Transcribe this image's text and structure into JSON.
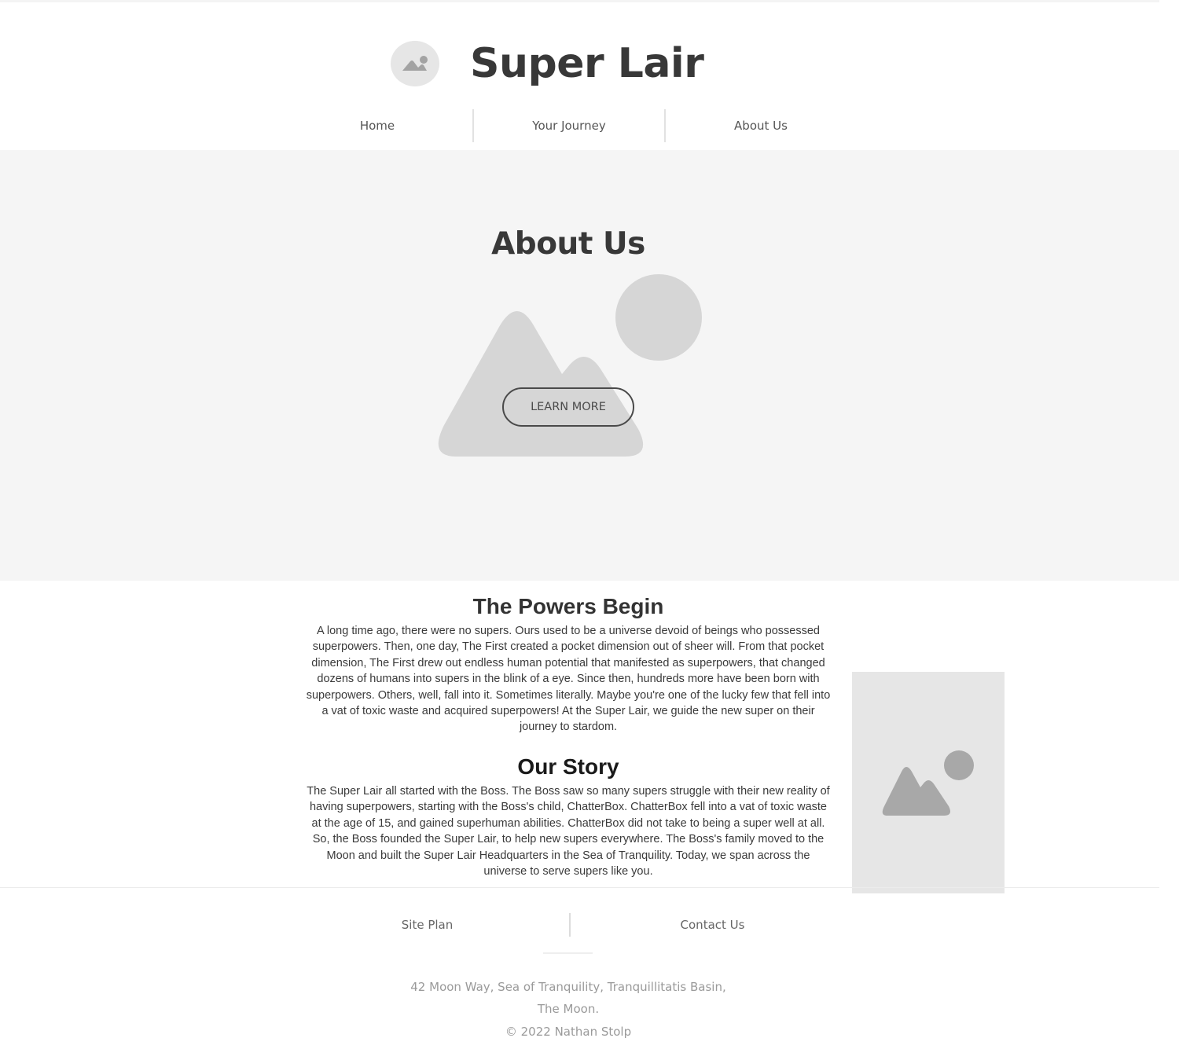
{
  "header": {
    "site_title": "Super Lair",
    "logo_icon": "image-placeholder-icon",
    "nav": [
      {
        "label": "Home"
      },
      {
        "label": "Your Journey"
      },
      {
        "label": "About Us"
      }
    ]
  },
  "hero": {
    "title": "About Us",
    "background_icon": "image-placeholder-icon",
    "cta_label": "LEARN MORE"
  },
  "sections": [
    {
      "title": "The Powers Begin",
      "body": "A long time ago, there were no supers. Ours used to be a universe devoid of beings who possessed superpowers. Then, one day, The First created a pocket dimension out of sheer will. From that pocket dimension, The First drew out endless human potential that manifested as superpowers, that changed dozens of humans into supers in the blink of a eye. Since then, hundreds more have been born with superpowers. Others, well, fall into it. Sometimes literally. Maybe you're one of the lucky few that fell into a vat of toxic waste and acquired superpowers! At the Super Lair, we guide the new super on their journey to stardom."
    },
    {
      "title": "Our Story",
      "body": "The Super Lair all started with the Boss. The Boss saw so many supers struggle with their new reality of having superpowers, starting with the Boss's child, ChatterBox. ChatterBox fell into a vat of toxic waste at the age of 15, and gained superhuman abilities. ChatterBox did not take to being a super well at all. So, the Boss founded the Super Lair, to help new supers everywhere. The Boss's family moved to the Moon and built the Super Lair Headquarters in the Sea of Tranquility. Today, we span across the universe to serve supers like you."
    }
  ],
  "side_image_icon": "image-placeholder-icon",
  "footer": {
    "links": [
      {
        "label": "Site Plan"
      },
      {
        "label": "Contact Us"
      }
    ],
    "address_line1": "42 Moon Way, Sea of Tranquility, Tranquillitatis Basin,",
    "address_line2": "The Moon.",
    "copyright": "© 2022 Nathan Stolp"
  },
  "colors": {
    "hero_background": "#f5f5f5",
    "placeholder_fill": "#d6d6d6",
    "text_dark": "#383838"
  }
}
